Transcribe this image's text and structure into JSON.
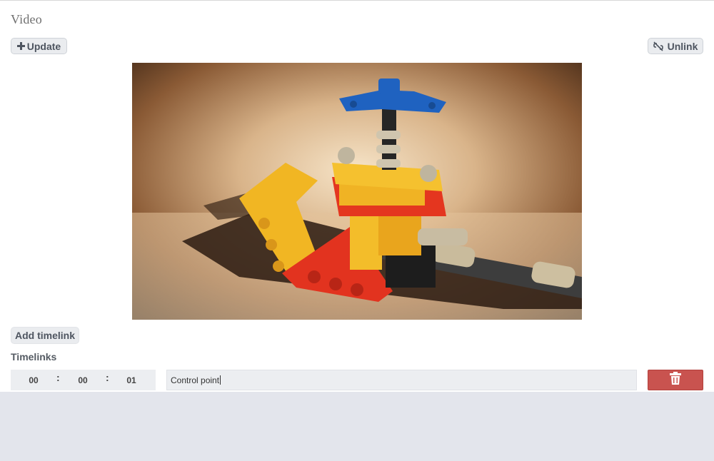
{
  "section": {
    "title": "Video"
  },
  "toolbar": {
    "update_label": "Update",
    "update_icon": "plus-icon",
    "unlink_label": "Unlink",
    "unlink_icon": "unlink-icon"
  },
  "video": {
    "subject": "lego technic model on table",
    "palette": {
      "background": "#3a2414",
      "yellow": "#f2b824",
      "red": "#e0321e",
      "blue": "#1e5fb8",
      "grey": "#c9bfa8"
    }
  },
  "timelinks": {
    "add_label": "Add timelink",
    "heading": "Timelinks",
    "items": [
      {
        "hours": "00",
        "minutes": "00",
        "seconds": "01",
        "label": "Control point",
        "delete_icon": "trash-icon"
      }
    ]
  },
  "colors": {
    "delete": "#c9534f",
    "page_background": "#e3e5ec",
    "button": "#eaecef"
  }
}
